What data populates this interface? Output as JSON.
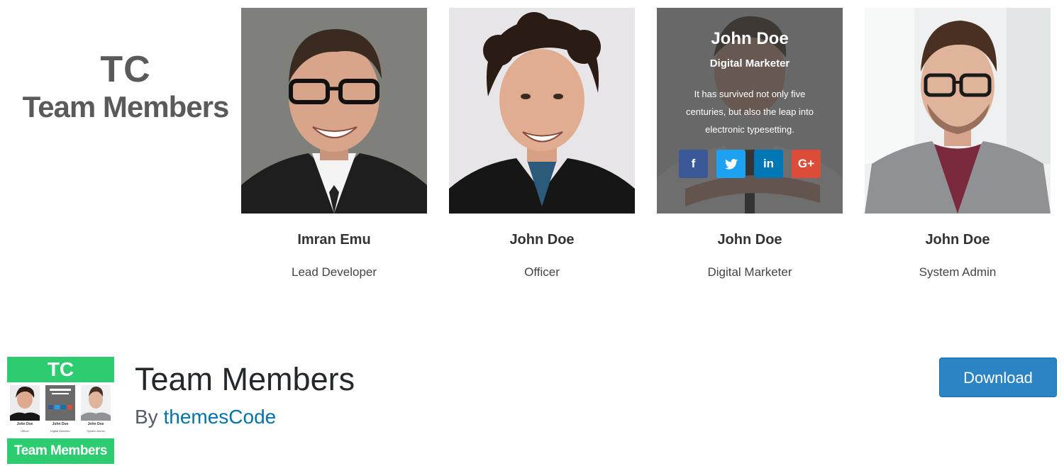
{
  "banner": {
    "brand_tc": "TC",
    "brand_title": "Team Members",
    "members": [
      {
        "name": "Imran Emu",
        "role": "Lead Developer"
      },
      {
        "name": "John Doe",
        "role": "Officer"
      },
      {
        "name": "John Doe",
        "role": "Digital Marketer",
        "overlay": {
          "name": "John Doe",
          "role": "Digital Marketer",
          "bio": "It has survived not only five centuries, but also the leap into electronic typesetting.",
          "social": [
            "f",
            "t",
            "in",
            "G+"
          ]
        }
      },
      {
        "name": "John Doe",
        "role": "System Admin"
      }
    ],
    "social_colors": {
      "facebook": "#3b5998",
      "twitter": "#1da1f2",
      "linkedin": "#0077b5",
      "google": "#dd4b39"
    }
  },
  "plugin": {
    "icon": {
      "top": "TC",
      "bottom": "Team Members",
      "mini_names": [
        "John Doe",
        "John Doe",
        "John Doe"
      ],
      "mini_roles": [
        "Officer",
        "Digital Marketer",
        "System Admin"
      ]
    },
    "title": "Team Members",
    "by_prefix": "By ",
    "author": "themesCode",
    "download_label": "Download"
  },
  "colors": {
    "accent": "#2b84c4",
    "brand_green": "#2ecc71",
    "link": "#0073aa"
  }
}
